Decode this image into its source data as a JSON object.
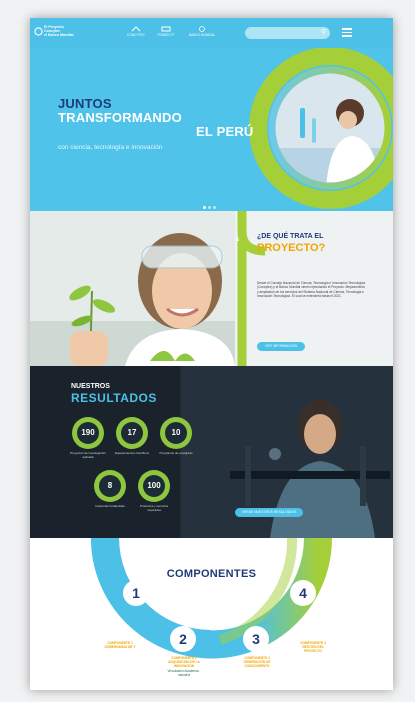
{
  "header": {
    "logo_text": "El Proyecto\nConcytec\nel Banco Mundial",
    "partners": [
      "CONCYTEC",
      "FONDECYT",
      "BANCO MUNDIAL"
    ],
    "search_icon": "search-icon",
    "menu_icon": "hamburger-menu-icon"
  },
  "hero": {
    "line1": "JUNTOS",
    "line2": "TRANSFORMANDO",
    "line3": "EL PERÚ",
    "tagline": "con ciencia, tecnología e innovación"
  },
  "project": {
    "title_small": "¿DE QUÉ TRATA EL",
    "title_big": "PROYECTO?",
    "body": "Desde el Consejo Nacional de Ciencia, Tecnología e Innovación Tecnológica (Concytec) y el Banco Mundial vienen ejecutando el Proyecto: Mejoramiento y ampliación de los servicios del Sistema Nacional de Ciencia, Tecnología e Innovación Tecnológica. El cual se extenderá hasta el 2021.",
    "button": "VER INFORMACIÓN"
  },
  "results": {
    "title_small": "NUESTROS",
    "title_big": "RESULTADOS",
    "stats": [
      {
        "value": "190",
        "label": "Proyectos de investigación aplicada"
      },
      {
        "value": "17",
        "label": "Equipamientos científicos"
      },
      {
        "value": "10",
        "label": "Programas de postgrado"
      },
      {
        "value": "8",
        "label": "Instancias fortalecidas"
      },
      {
        "value": "100",
        "label": "Productos y servicios mejorados"
      }
    ],
    "button": "VERSE NUESTROS RESULTADOS"
  },
  "components": {
    "title": "COMPONENTES",
    "items": [
      {
        "number": "1",
        "label": "COMPONENTE 1 GOBERNANZA DE Y"
      },
      {
        "number": "2",
        "label": "COMPONENTE 2 ADQUISICIÓN DE LA INNOVACIÓN",
        "sub": "Vinculación Academia - Industria"
      },
      {
        "number": "3",
        "label": "COMPONENTE 3 GENERACIÓN DE CONOCIMIENTO"
      },
      {
        "number": "4",
        "label": "COMPONENTE 4 GESTIÓN DEL PROYECTO"
      }
    ]
  },
  "colors": {
    "brand_blue": "#4cc0e6",
    "brand_green": "#8ec63f",
    "navy": "#1f3a7a",
    "orange": "#f0a500"
  }
}
